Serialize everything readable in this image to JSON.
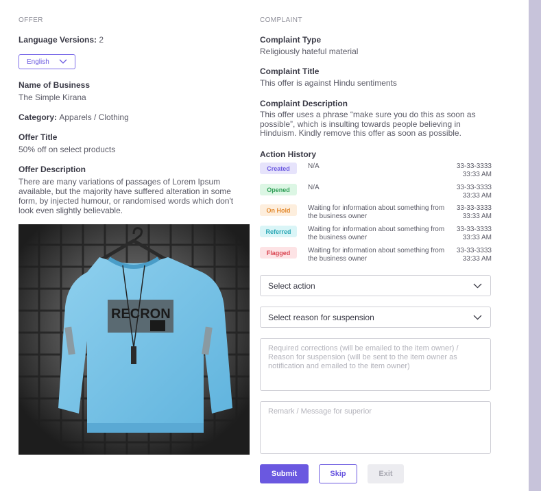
{
  "offer": {
    "section_label": "OFFER",
    "language_versions_label": "Language Versions:",
    "language_versions_count": "2",
    "language_select": "English",
    "business_name_label": "Name of Business",
    "business_name": "The Simple Kirana",
    "category_label": "Category:",
    "category": "Apparels / Clothing",
    "offer_title_label": "Offer Title",
    "offer_title": "50% off on select products",
    "offer_description_label": "Offer Description",
    "offer_description": "There are many variations of passages of Lorem Ipsum available, but the majority have suffered alteration in some form, by injected humour, or randomised words which don't look even slightly believable.",
    "image_shirt_print": "RECRON"
  },
  "complaint": {
    "section_label": "COMPLAINT",
    "type_label": "Complaint Type",
    "type": "Religiously hateful material",
    "title_label": "Complaint Title",
    "title": "This offer is against Hindu sentiments",
    "description_label": "Complaint Description",
    "description": "This offer uses a phrase “make sure you do this as soon as possible”, which is insulting towards people believing in Hinduism. Kindly remove this offer as soon as possible.",
    "action_history_label": "Action History",
    "history": [
      {
        "status": "Created",
        "text": "N/A",
        "date": "33-33-3333",
        "time": "33:33 AM",
        "bg": "#e6e3fb",
        "fg": "#6a58e0"
      },
      {
        "status": "Opened",
        "text": "N/A",
        "date": "33-33-3333",
        "time": "33:33 AM",
        "bg": "#dcf6e4",
        "fg": "#2f9e56"
      },
      {
        "status": "On Hold",
        "text": "Waiting for information about something from the business owner",
        "date": "33-33-3333",
        "time": "33:33 AM",
        "bg": "#fdeedd",
        "fg": "#e38a2f"
      },
      {
        "status": "Referred",
        "text": "Waiting for information about something from the business owner",
        "date": "33-33-3333",
        "time": "33:33 AM",
        "bg": "#daf5f7",
        "fg": "#2aa7b5"
      },
      {
        "status": "Flagged",
        "text": "Waiting for information about something from the business owner",
        "date": "33-33-3333",
        "time": "33:33 AM",
        "bg": "#fde3e5",
        "fg": "#d9434f"
      }
    ]
  },
  "form": {
    "select_action": "Select action",
    "select_reason": "Select reason for suspension",
    "corrections_placeholder": "Required corrections (will be emailed to the item owner) / Reason for suspension (will be sent to the item owner as notification and emailed to the item owner)",
    "remark_placeholder": "Remark / Message for superior",
    "submit_label": "Submit",
    "skip_label": "Skip",
    "exit_label": "Exit"
  },
  "colors": {
    "accent": "#6a58e0",
    "rail": "#c7c3da",
    "disabled_bg": "#ececf0",
    "disabled_fg": "#a9a9b2"
  }
}
